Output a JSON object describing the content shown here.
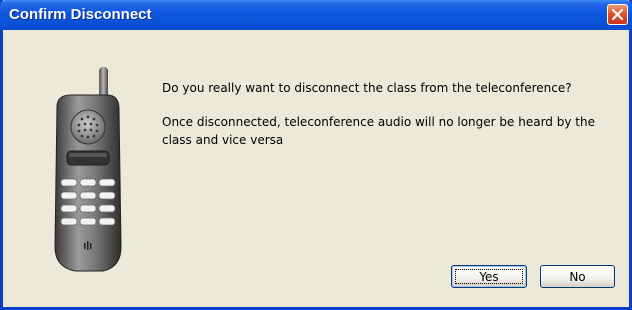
{
  "window": {
    "title": "Confirm Disconnect"
  },
  "titlebar": {
    "close_icon": "close-icon"
  },
  "phone_icon": "phone-icon",
  "message": {
    "line1": "Do you really want to disconnect the class from the teleconference?",
    "line2": "Once disconnected, teleconference audio will no longer be heard by the class and vice versa"
  },
  "buttons": {
    "yes_label": "Yes",
    "no_label": "No"
  },
  "colors": {
    "titlebar": "#0b53d8",
    "close_button": "#e0532a",
    "dialog_background": "#ece9d8"
  }
}
